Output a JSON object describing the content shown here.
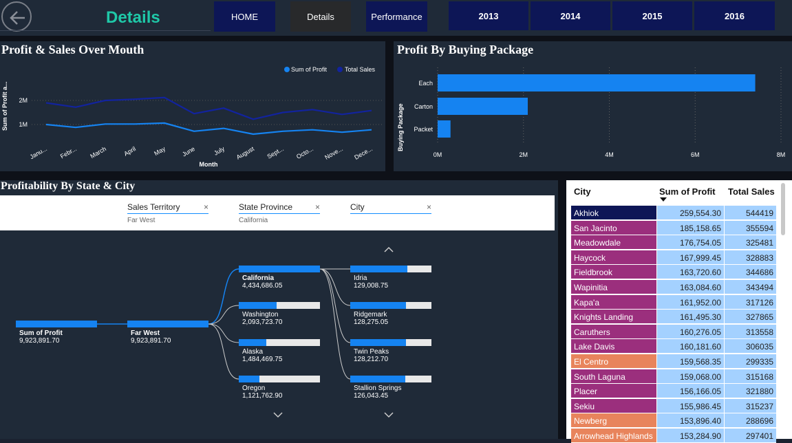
{
  "header": {
    "title": "Details",
    "nav": [
      {
        "label": "HOME",
        "bg": "#0d1656"
      },
      {
        "label": "Details",
        "bg": "#28292b"
      },
      {
        "label": "Performance",
        "bg": "#0d1656"
      }
    ],
    "years": [
      "2013",
      "2014",
      "2015",
      "2016"
    ]
  },
  "line_chart": {
    "title": "Profit & Sales Over Mouth",
    "legend": [
      "Sum of Profit",
      "Total Sales"
    ],
    "ylabel": "Sum of Profit a...",
    "xlabel": "Month",
    "yticks": [
      "2M",
      "1M"
    ],
    "months": [
      "Janu...",
      "Febr...",
      "March",
      "April",
      "May",
      "June",
      "July",
      "August",
      "Sept...",
      "Octo...",
      "Nove...",
      "Dece..."
    ]
  },
  "bar_chart": {
    "title": "Profit By Buying Package",
    "ylabel": "Buying Package",
    "xticks": [
      "0M",
      "2M",
      "4M",
      "6M",
      "8M"
    ]
  },
  "chart_data": [
    {
      "type": "line",
      "title": "Profit & Sales Over Mouth",
      "categories": [
        "Janu...",
        "Febr...",
        "March",
        "April",
        "May",
        "June",
        "July",
        "August",
        "Sept...",
        "Octo...",
        "Nove...",
        "Dece..."
      ],
      "series": [
        {
          "name": "Sum of Profit",
          "values": [
            1.0,
            0.88,
            1.02,
            1.02,
            1.06,
            0.72,
            0.84,
            0.6,
            0.72,
            0.78,
            0.68,
            0.78
          ]
        },
        {
          "name": "Total Sales",
          "values": [
            1.9,
            1.72,
            2.0,
            2.05,
            2.12,
            1.45,
            1.68,
            1.22,
            1.5,
            1.62,
            1.42,
            1.58
          ]
        }
      ],
      "xlabel": "Month",
      "ylabel": "Sum of Profit a...",
      "ylim": [
        0,
        2.6
      ],
      "colors": [
        "#1583f1",
        "#12239e"
      ]
    },
    {
      "type": "bar",
      "orientation": "horizontal",
      "title": "Profit By Buying Package",
      "categories": [
        "Each",
        "Carton",
        "Packet"
      ],
      "values": [
        7.4,
        2.1,
        0.3
      ],
      "xlim": [
        0,
        8
      ],
      "ylabel": "Buying Package",
      "color": "#1583f1"
    }
  ],
  "decomp": {
    "title": "Profitability By State & City",
    "filters": [
      {
        "label": "Sales Territory",
        "value": "Far West"
      },
      {
        "label": "State Province",
        "value": "California"
      },
      {
        "label": "City",
        "value": ""
      }
    ],
    "root": {
      "name": "Sum of Profit",
      "value": "9,923,891.70"
    },
    "level1": {
      "name": "Far West",
      "value": "9,923,891.70"
    },
    "states": [
      {
        "name": "California",
        "value": "4,434,686.05",
        "fill": 1.0
      },
      {
        "name": "Washington",
        "value": "2,093,723.70",
        "fill": 0.47
      },
      {
        "name": "Alaska",
        "value": "1,484,469.75",
        "fill": 0.34
      },
      {
        "name": "Oregon",
        "value": "1,121,762.90",
        "fill": 0.25
      }
    ],
    "cities": [
      {
        "name": "Idria",
        "value": "129,008.75",
        "fill": 0.7
      },
      {
        "name": "Ridgemark",
        "value": "128,275.05",
        "fill": 0.69
      },
      {
        "name": "Twin Peaks",
        "value": "128,212.70",
        "fill": 0.69
      },
      {
        "name": "Stallion Springs",
        "value": "126,043.45",
        "fill": 0.68
      }
    ]
  },
  "table": {
    "headers": [
      "City",
      "Sum of Profit",
      "Total Sales"
    ],
    "rows": [
      {
        "city": "Akhiok",
        "profit": "259,554.30",
        "sales": "544419",
        "color": "#0d1656"
      },
      {
        "city": "San Jacinto",
        "profit": "185,158.65",
        "sales": "355594",
        "color": "#9b2f7d"
      },
      {
        "city": "Meadowdale",
        "profit": "176,754.05",
        "sales": "325481",
        "color": "#9b2f7d"
      },
      {
        "city": "Haycock",
        "profit": "167,999.45",
        "sales": "328883",
        "color": "#9b2f7d"
      },
      {
        "city": "Fieldbrook",
        "profit": "163,720.60",
        "sales": "344686",
        "color": "#9b2f7d"
      },
      {
        "city": "Wapinitia",
        "profit": "163,084.60",
        "sales": "343494",
        "color": "#9b2f7d"
      },
      {
        "city": "Kapa'a",
        "profit": "161,952.00",
        "sales": "317126",
        "color": "#9b2f7d"
      },
      {
        "city": "Knights Landing",
        "profit": "161,495.30",
        "sales": "327865",
        "color": "#9b2f7d"
      },
      {
        "city": "Caruthers",
        "profit": "160,276.05",
        "sales": "313558",
        "color": "#9b2f7d"
      },
      {
        "city": "Lake Davis",
        "profit": "160,181.60",
        "sales": "306035",
        "color": "#9b2f7d"
      },
      {
        "city": "El Centro",
        "profit": "159,568.35",
        "sales": "299335",
        "color": "#e8845c"
      },
      {
        "city": "South Laguna",
        "profit": "159,068.00",
        "sales": "315168",
        "color": "#9b2f7d"
      },
      {
        "city": "Placer",
        "profit": "156,166.05",
        "sales": "321880",
        "color": "#9b2f7d"
      },
      {
        "city": "Sekiu",
        "profit": "155,986.45",
        "sales": "315237",
        "color": "#9b2f7d"
      },
      {
        "city": "Newberg",
        "profit": "153,896.40",
        "sales": "288696",
        "color": "#e8845c"
      },
      {
        "city": "Arrowhead Highlands",
        "profit": "153,284.90",
        "sales": "297401",
        "color": "#e8845c"
      }
    ]
  }
}
